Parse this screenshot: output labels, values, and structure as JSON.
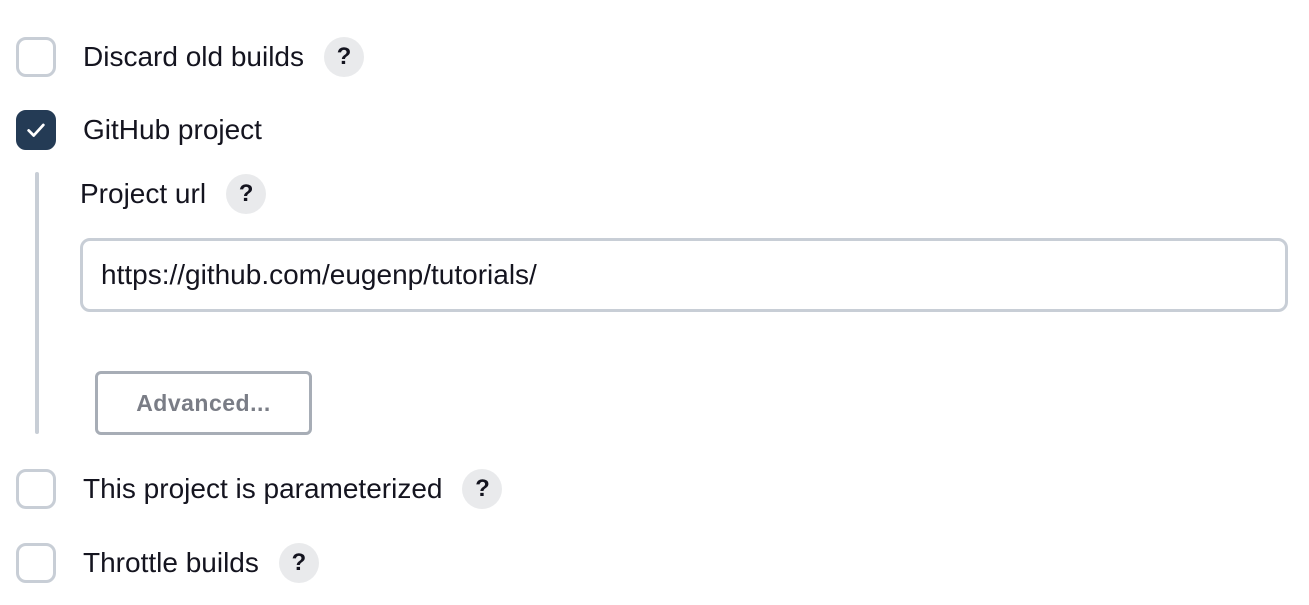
{
  "options": {
    "discard_old_builds": {
      "label": "Discard old builds",
      "checked": false,
      "help": "?"
    },
    "github_project": {
      "label": "GitHub project",
      "checked": true
    },
    "parameterized": {
      "label": "This project is parameterized",
      "checked": false,
      "help": "?"
    },
    "throttle_builds": {
      "label": "Throttle builds",
      "checked": false,
      "help": "?"
    }
  },
  "github_section": {
    "project_url_label": "Project url",
    "project_url_help": "?",
    "project_url_value": "https://github.com/eugenp/tutorials/",
    "advanced_label": "Advanced..."
  },
  "colors": {
    "checkbox_checked": "#243b55",
    "checkbox_border": "#c8ced6",
    "help_bg": "#e9eaec",
    "text": "#14141f",
    "button_text": "#7a7d86"
  },
  "icons": {
    "check": "check-icon",
    "help": "help-icon"
  }
}
